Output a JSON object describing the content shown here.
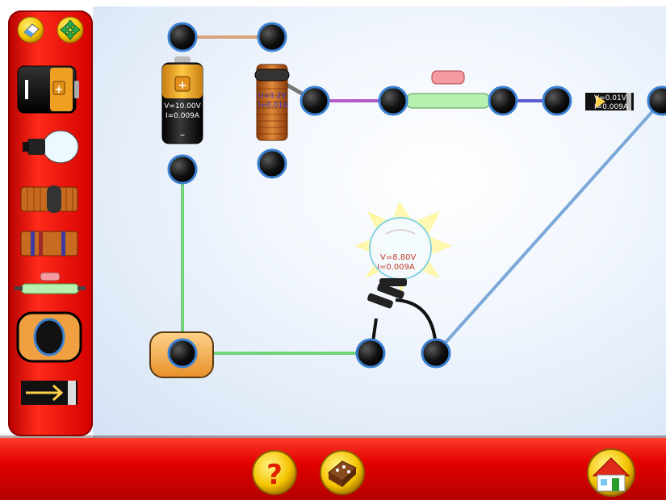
{
  "colors": {
    "panel_red": "#e00000",
    "wire_green": "#6fd47a",
    "wire_blue": "#7aa8d8",
    "wire_purple": "#b35cc8",
    "wire_tan": "#d9a27a",
    "connector_ring": "#3a7fd0"
  },
  "toolbar": {
    "top_buttons": [
      {
        "name": "eraser-button",
        "icon": "eraser-icon"
      },
      {
        "name": "move-button",
        "icon": "move-arrows-icon"
      }
    ],
    "tools": [
      {
        "name": "battery",
        "icon": "battery-icon"
      },
      {
        "name": "light-bulb",
        "icon": "bulb-icon"
      },
      {
        "name": "inductor",
        "icon": "coil-icon"
      },
      {
        "name": "resistor",
        "icon": "resistor-icon"
      },
      {
        "name": "switch",
        "icon": "push-switch-icon"
      },
      {
        "name": "ammeter",
        "icon": "meter-icon"
      },
      {
        "name": "diode",
        "icon": "diode-icon"
      }
    ]
  },
  "circuit": {
    "battery": {
      "plus": "+",
      "minus": "–",
      "voltage": "V=10.00V",
      "current": "I=0.009A"
    },
    "coil": {
      "voltage": "U=1.2V",
      "current": "I=0.01A"
    },
    "diode": {
      "voltage": "V=0.01V",
      "current": "I=0.009A"
    },
    "bulb": {
      "voltage": "V=8.80V",
      "current": "I=0.009A"
    }
  },
  "bottom": {
    "buttons": [
      {
        "name": "help-button",
        "icon": "question-mark-icon",
        "label": "?"
      },
      {
        "name": "chocolate-button",
        "icon": "chocolate-icon"
      },
      {
        "name": "home-button",
        "icon": "house-icon"
      }
    ]
  }
}
